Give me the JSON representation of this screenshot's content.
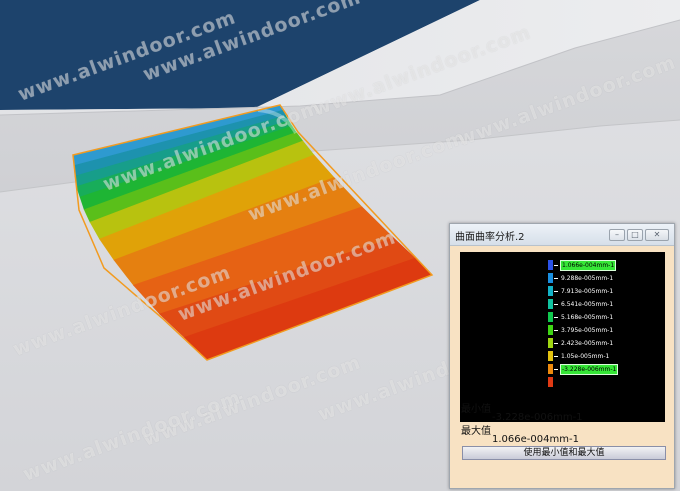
{
  "window": {
    "title": "曲面曲率分析.2",
    "minimize_glyph": "–",
    "maximize_glyph": "□",
    "close_glyph": "✕"
  },
  "legend": {
    "entries": [
      {
        "label": "1.066e-004mm-1",
        "color": "#2b52e8",
        "highlight": true
      },
      {
        "label": "9.288e-005mm-1",
        "color": "#1a8fe0",
        "highlight": false
      },
      {
        "label": "7.913e-005mm-1",
        "color": "#13b3c8",
        "highlight": false
      },
      {
        "label": "6.541e-005mm-1",
        "color": "#10c2a0",
        "highlight": false
      },
      {
        "label": "5.168e-005mm-1",
        "color": "#10c84e",
        "highlight": false
      },
      {
        "label": "3.795e-005mm-1",
        "color": "#3fd614",
        "highlight": false
      },
      {
        "label": "2.423e-005mm-1",
        "color": "#9fd612",
        "highlight": false
      },
      {
        "label": "1.05e-005mm-1",
        "color": "#e3c210",
        "highlight": false
      },
      {
        "label": "-3.228e-006mm-1",
        "color": "#ee8a0d",
        "highlight": true
      },
      {
        "label": "",
        "color": "#e03a14",
        "highlight": false
      }
    ]
  },
  "min": {
    "label": "最小值",
    "value": "-3.228e-006mm-1"
  },
  "max": {
    "label": "最大值",
    "value": "1.066e-004mm-1"
  },
  "button": {
    "label": "使用最小值和最大值"
  },
  "watermark": "www.alwindoor.com",
  "colors": {
    "viewport_bg": "#dcdde0",
    "sky": "#1d436c",
    "dialog_bg": "#f8e2c3",
    "surface_stripes": [
      "#2e9ad0",
      "#1d92ae",
      "#179e8a",
      "#18ad5a",
      "#1eb534",
      "#5abf1a",
      "#b8c20f",
      "#e0a208",
      "#e58010",
      "#e66214",
      "#e04a14",
      "#dd3a10"
    ]
  }
}
